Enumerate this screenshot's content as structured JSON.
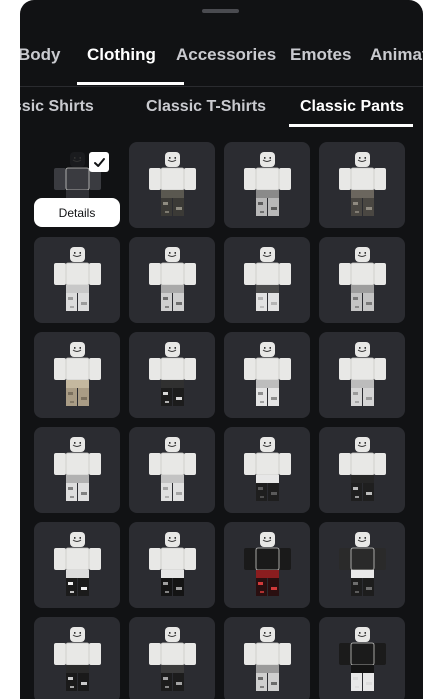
{
  "category_tabs": [
    {
      "label": "Body",
      "active": false
    },
    {
      "label": "Clothing",
      "active": true
    },
    {
      "label": "Accessories",
      "active": false
    },
    {
      "label": "Emotes",
      "active": false
    },
    {
      "label": "Animations",
      "active": false
    }
  ],
  "subcategory_tabs": [
    {
      "label": "Classic Shirts",
      "active": false
    },
    {
      "label": "Classic T-Shirts",
      "active": false
    },
    {
      "label": "Classic Pants",
      "active": true
    }
  ],
  "details_label": "Details",
  "items": [
    {
      "pants": "dark-outfit",
      "selected": true
    },
    {
      "pants": "dark-camo",
      "selected": false
    },
    {
      "pants": "gray-chains",
      "selected": false
    },
    {
      "pants": "dark-cargo",
      "selected": false
    },
    {
      "pants": "white-ripped",
      "selected": false
    },
    {
      "pants": "gray-ripped",
      "selected": false
    },
    {
      "pants": "white-belt",
      "selected": false
    },
    {
      "pants": "gray-cargo",
      "selected": false
    },
    {
      "pants": "tan-cargo",
      "selected": false
    },
    {
      "pants": "black-boots",
      "selected": false
    },
    {
      "pants": "white-straps",
      "selected": false
    },
    {
      "pants": "light-gray",
      "selected": false
    },
    {
      "pants": "white-marble",
      "selected": false
    },
    {
      "pants": "light-ripped",
      "selected": false
    },
    {
      "pants": "black-white-split",
      "selected": false
    },
    {
      "pants": "dark-straps",
      "selected": false
    },
    {
      "pants": "black-white-patch",
      "selected": false
    },
    {
      "pants": "black-white",
      "selected": false
    },
    {
      "pants": "red-black",
      "selected": false
    },
    {
      "pants": "black-white-lace",
      "selected": false
    },
    {
      "pants": "black-torn",
      "selected": false
    },
    {
      "pants": "black-gray",
      "selected": false
    },
    {
      "pants": "gray-patterned",
      "selected": false
    },
    {
      "pants": "black-white-skirt",
      "selected": false
    }
  ],
  "colors": {
    "sheet_background": "#111214",
    "tile_background": "#2b2c31",
    "text_inactive": "#c9cacf",
    "text_active": "#ffffff"
  }
}
